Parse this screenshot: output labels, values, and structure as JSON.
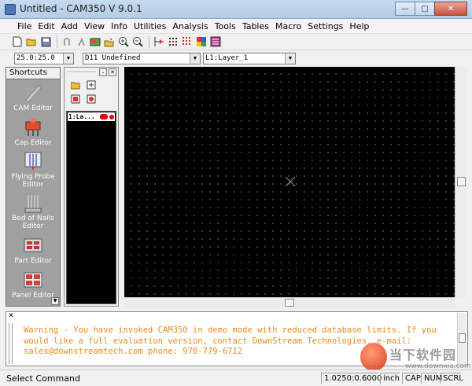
{
  "window": {
    "title": "Untitled - CAM350 V 9.0.1",
    "minimize": "—",
    "maximize": "□",
    "close": "✕"
  },
  "menu": [
    "File",
    "Edit",
    "Add",
    "View",
    "Info",
    "Utilities",
    "Analysis",
    "Tools",
    "Tables",
    "Macro",
    "Settings",
    "Help"
  ],
  "toolbar": {
    "icons": [
      "new-file-icon",
      "open-file-icon",
      "save-icon",
      "undo-icon",
      "redo-icon",
      "layer-table-icon",
      "import-icon",
      "zoom-in-icon",
      "zoom-out-icon",
      "snap-grid-icon",
      "redraw-icon",
      "grid-icon",
      "color-table-icon",
      "layer-view-icon"
    ]
  },
  "combos": {
    "grid": "25.0:25.0",
    "dcode": "D11   Undefined",
    "layer": "L1:Layer_1"
  },
  "shortcuts": {
    "header": "Shortcuts",
    "items": [
      {
        "label": "CAM Editor",
        "icon": "cam-editor-icon",
        "color": "#c8c8c8"
      },
      {
        "label": "Cap Editor",
        "icon": "cap-editor-icon",
        "color": "#e0502a"
      },
      {
        "label": "Flying Probe Editor",
        "icon": "flying-probe-icon",
        "color": "#7a88c8"
      },
      {
        "label": "Bed of Nails Editor",
        "icon": "bed-of-nails-icon",
        "color": "#d8d8d8"
      },
      {
        "label": "Part Editor",
        "icon": "part-editor-icon",
        "color": "#cc3030"
      },
      {
        "label": "Panel Editor",
        "icon": "panel-editor-icon",
        "color": "#d04040"
      }
    ]
  },
  "layers": {
    "rows": [
      {
        "name": "1:La...",
        "color": "#e00000"
      }
    ]
  },
  "message": {
    "text": "Warning - You have invoked CAM350 in demo mode with reduced database limits. If you\nwould like a full evaluation version, contact DownStream Technologies. e-mail:\nsales@downstreamtech.com phone: 978-779-6712"
  },
  "status": {
    "command": "Select Command",
    "coords": "1.0250:0.6000",
    "units": "inch",
    "cap": "CAP",
    "num": "NUM",
    "scrl": "SCRL"
  },
  "watermark": {
    "text": "当下软件园",
    "url": "www.downxia.com"
  }
}
